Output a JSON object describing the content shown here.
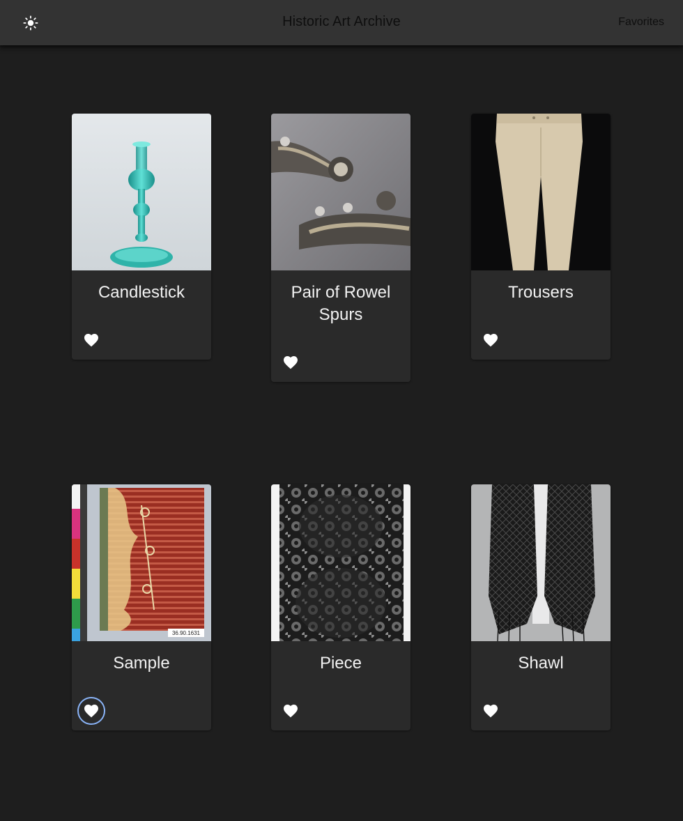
{
  "app_bar": {
    "title": "Historic Art Archive",
    "favorites_label": "Favorites",
    "theme_icon": "sun-icon"
  },
  "colors": {
    "background": "#1e1e1e",
    "app_bar": "#333333",
    "card": "#2a2a2a",
    "focus_ring": "#8ab4f8"
  },
  "cards": [
    {
      "title": "Candlestick",
      "favorite_icon": "heart-icon"
    },
    {
      "title": "Pair of Rowel Spurs",
      "favorite_icon": "heart-icon"
    },
    {
      "title": "Trousers",
      "favorite_icon": "heart-icon"
    },
    {
      "title": "Sample",
      "favorite_icon": "heart-icon",
      "image_label": "36.90.1631",
      "focused": true
    },
    {
      "title": "Piece",
      "favorite_icon": "heart-icon"
    },
    {
      "title": "Shawl",
      "favorite_icon": "heart-icon"
    }
  ]
}
